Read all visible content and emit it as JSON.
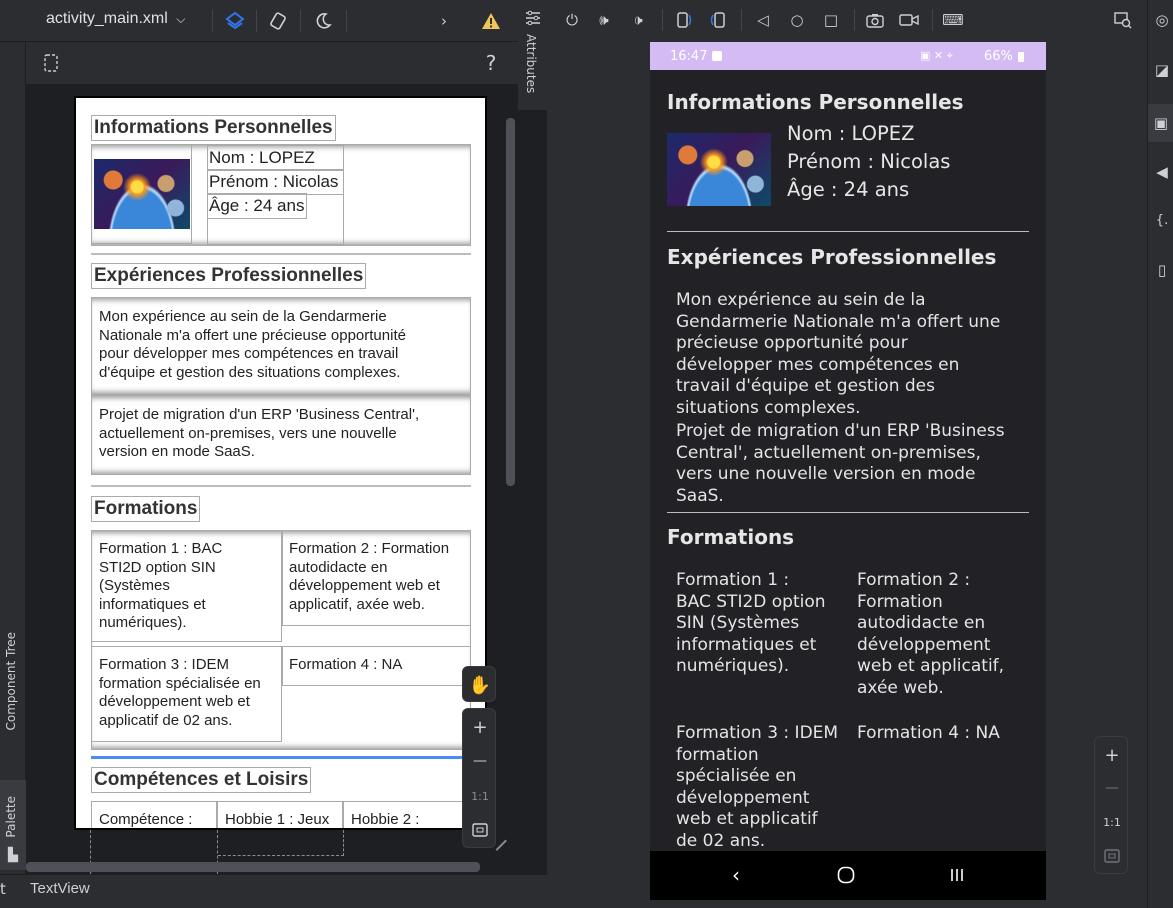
{
  "editor": {
    "file_tab": "activity_main.xml",
    "attributes_label": "Attributes",
    "help_label": "?",
    "component_tree_label": "Component Tree",
    "palette_label": "Palette",
    "breadcrumb_prefix": "t",
    "breadcrumb": "TextView"
  },
  "zoom": {
    "plus": "+",
    "minus": "—",
    "one_to_one": "1:1"
  },
  "cv": {
    "section_personal": "Informations Personnelles",
    "nom": "Nom : LOPEZ",
    "prenom": "Prénom : Nicolas",
    "age": "Âge : 24 ans",
    "section_experience": "Expériences Professionnelles",
    "exp1": "Mon expérience au sein de la Gendarmerie Nationale m'a offert une précieuse opportunité pour développer mes compétences en travail d'équipe et gestion des situations complexes.",
    "exp2": "Projet de migration d'un ERP 'Business Central', actuellement on-premises, vers une nouvelle version en mode SaaS.",
    "section_formations": "Formations",
    "f1": "Formation 1 : BAC STI2D option SIN (Systèmes informatiques et numériques).",
    "f2": "Formation 2 : Formation autodidacte en développement web et applicatif, axée web.",
    "f3": "Formation 3 : IDEM formation spécialisée en développement web et applicatif de 02 ans.",
    "f4": "Formation 4 : NA",
    "section_skills": "Compétences et Loisirs",
    "skill": "Compétence :",
    "hobby1": "Hobbie 1 : Jeux",
    "hobby2": "Hobbie 2 :"
  },
  "phone": {
    "time": "16:47",
    "battery": "66%"
  }
}
